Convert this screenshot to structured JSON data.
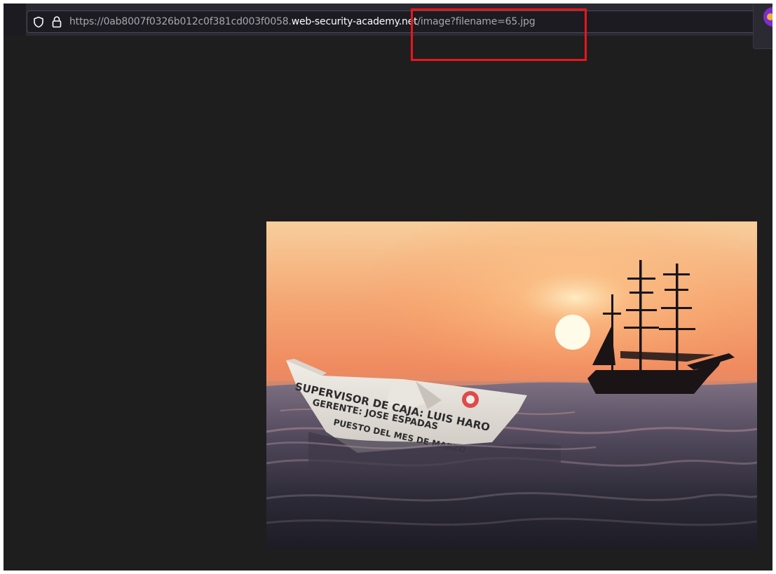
{
  "browser": {
    "url_bar": {
      "scheme": "https://",
      "subdomain": "0ab8007f0326b012c0f381cd003f0058.",
      "host": "web-security-academy.net",
      "path": "/image?filename=65.jpg"
    }
  },
  "annotation": {
    "color": "#e8161a"
  },
  "viewer": {
    "image_caption_lines": [
      "SUPERVISOR DE CAJA: LUIS HARO",
      "GERENTE: JOSE ESPADAS",
      "PUESTO DEL MES DE MARZO"
    ]
  },
  "theme": {
    "page_background": "#1e1e1f",
    "toolbar_background": "#2b2a33",
    "url_host_color": "#fbfbfe",
    "url_dim_color": "#a7a7b0"
  }
}
